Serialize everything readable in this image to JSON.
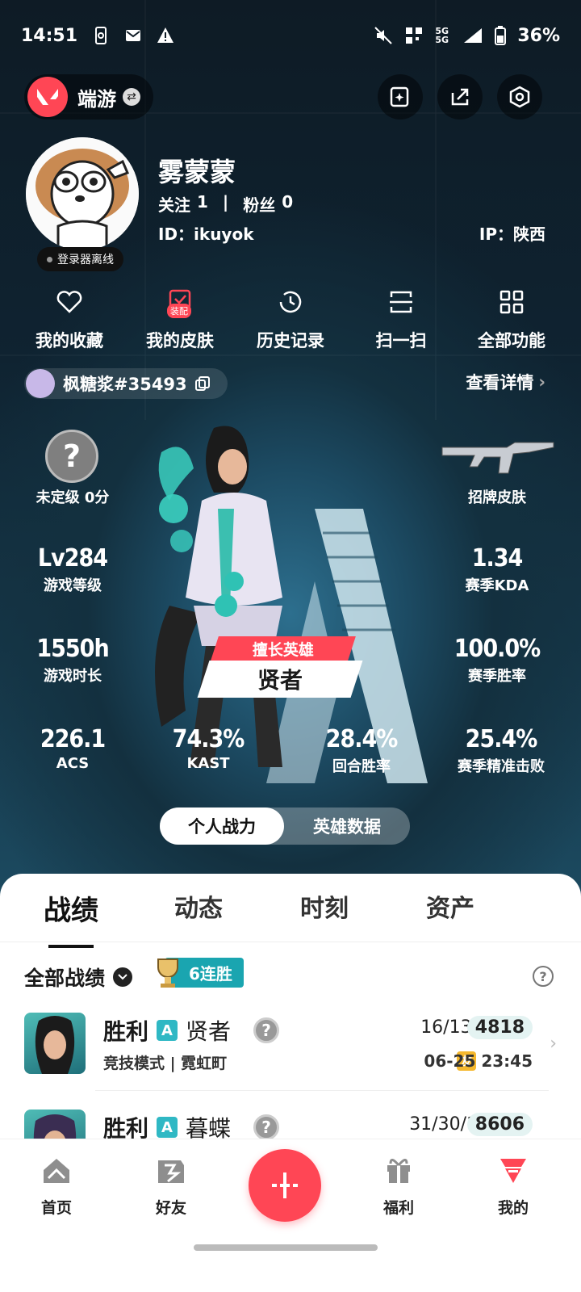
{
  "status_bar": {
    "time": "14:51",
    "network": "5G 5G",
    "battery": "36%"
  },
  "header": {
    "app_name": "端游"
  },
  "profile": {
    "nickname": "雾蒙蒙",
    "follow_label": "关注",
    "follow_count": "1",
    "separator": "|",
    "fans_label": "粉丝",
    "fans_count": "0",
    "id_text": "ID：ikuyok",
    "ip_text": "IP：陕西",
    "offline_text": "登录器离线"
  },
  "quick_menu": [
    {
      "label": "我的收藏",
      "icon": "heart-icon"
    },
    {
      "label": "我的皮肤",
      "icon": "skin-icon",
      "badge": "装配"
    },
    {
      "label": "历史记录",
      "icon": "history-icon"
    },
    {
      "label": "扫一扫",
      "icon": "scan-icon"
    },
    {
      "label": "全部功能",
      "icon": "grid-icon"
    }
  ],
  "game_account": {
    "name": "枫糖浆#35493",
    "detail_label": "查看详情"
  },
  "stats": {
    "rank_symbol": "?",
    "rank_label": "未定级 0分",
    "skin_label": "招牌皮肤",
    "level": {
      "value": "Lv284",
      "label": "游戏等级"
    },
    "kda": {
      "value": "1.34",
      "label": "赛季KDA"
    },
    "playtime": {
      "value": "1550h",
      "label": "游戏时长"
    },
    "winrate": {
      "value": "100.0%",
      "label": "赛季胜率"
    },
    "acs": {
      "value": "226.1",
      "label": "ACS"
    },
    "kast": {
      "value": "74.3%",
      "label": "KAST"
    },
    "round_win": {
      "value": "28.4%",
      "label": "回合胜率"
    },
    "precision": {
      "value": "25.4%",
      "label": "赛季精准击败"
    },
    "best_agent_tag": "擅长英雄",
    "best_agent": "贤者"
  },
  "toggle": {
    "active": "个人战力",
    "inactive": "英雄数据"
  },
  "tabs": [
    "战绩",
    "动态",
    "时刻",
    "资产"
  ],
  "record_filter": {
    "label": "全部战绩",
    "streak": "6连胜",
    "help": "?"
  },
  "matches": [
    {
      "result": "胜利",
      "badge": "A",
      "agent": "贤者",
      "mode": "竞技模式 | 霓虹町",
      "kda": "16/13/4",
      "score": "4818",
      "friend_tag": "友",
      "time": "06-25 23:45"
    },
    {
      "result": "胜利",
      "badge": "A",
      "agent": "暮蝶",
      "mode": "",
      "kda": "31/30/16",
      "score": "8606",
      "friend_tag": "",
      "time": ""
    }
  ],
  "bottom_nav": [
    {
      "label": "首页",
      "icon": "home-icon"
    },
    {
      "label": "好友",
      "icon": "friends-icon"
    },
    {
      "label": "福利",
      "icon": "gift-icon"
    },
    {
      "label": "我的",
      "icon": "profile-icon"
    }
  ],
  "colors": {
    "accent": "#ff4655",
    "teal": "#1aa5b0",
    "dark_bg": "#0d1a24"
  }
}
